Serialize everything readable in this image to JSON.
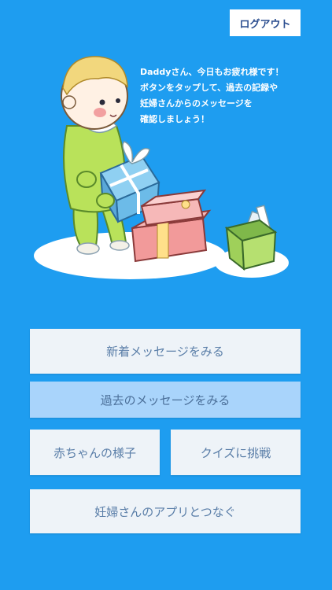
{
  "header": {
    "logout_label": "ログアウト"
  },
  "greeting": {
    "lines": [
      "Daddyさん、今日もお疲れ様です！",
      "ボタンをタップして、過去の記録や",
      "妊婦さんからのメッセージを",
      "確認しましょう！"
    ]
  },
  "menu": {
    "new_messages": "新着メッセージをみる",
    "past_messages": "過去のメッセージをみる",
    "baby_status": "赤ちゃんの様子",
    "quiz": "クイズに挑戦",
    "connect_app": "妊婦さんのアプリとつなぐ"
  },
  "colors": {
    "background": "#1e9df0",
    "button_bg": "#eef3f8",
    "button_text": "#5a7ea8",
    "button_active_bg": "#a9d4fb"
  }
}
